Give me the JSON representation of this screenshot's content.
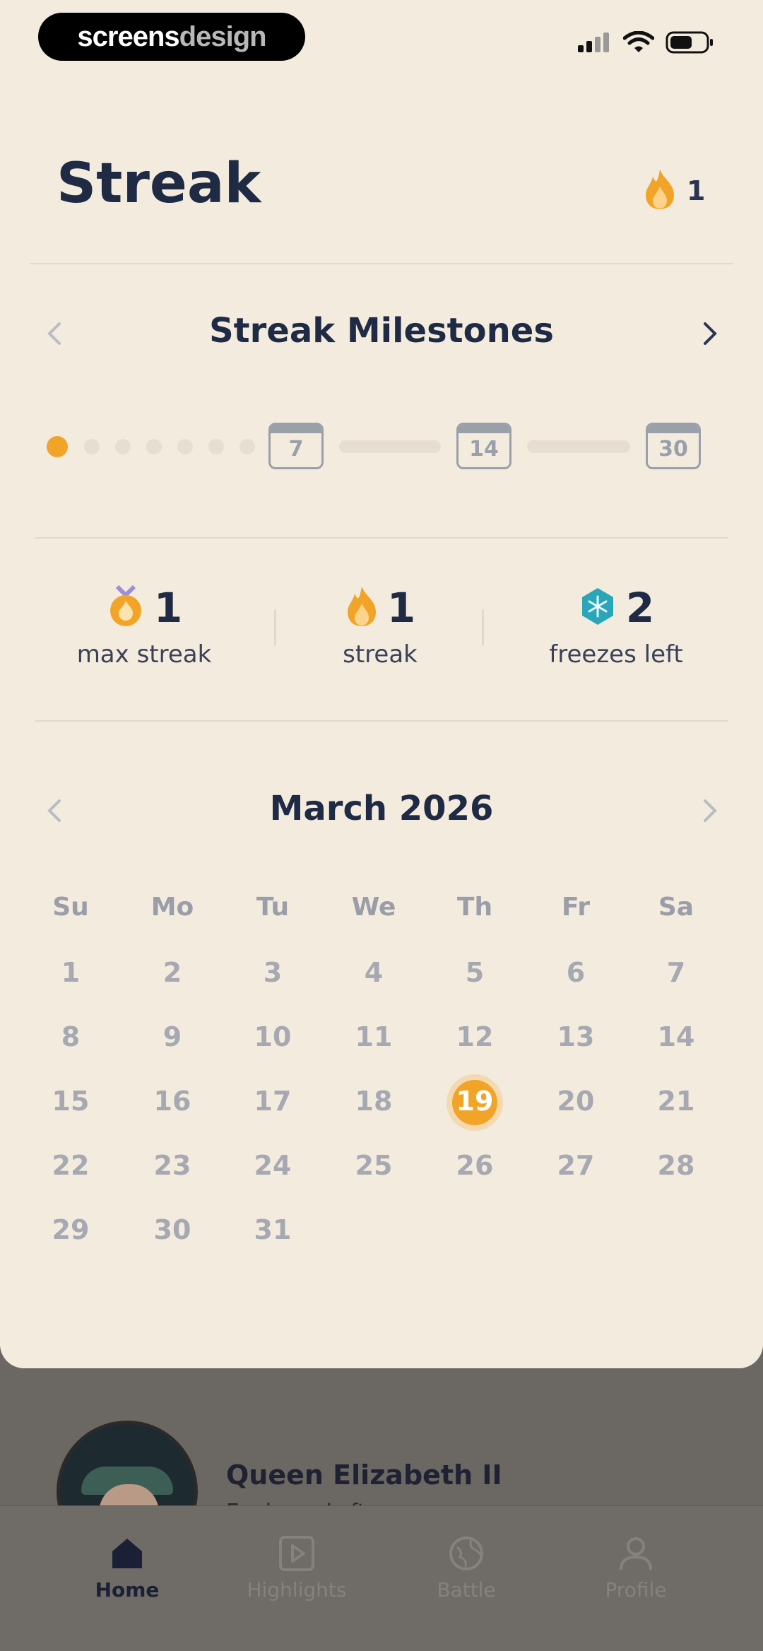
{
  "status_bar": {
    "badge_part1": "screens",
    "badge_part2": "design"
  },
  "header": {
    "title": "Streak",
    "streak_count": "1"
  },
  "milestones": {
    "title": "Streak Milestones",
    "markers": [
      "7",
      "14",
      "30"
    ],
    "progress_days": 1
  },
  "stats": [
    {
      "value": "1",
      "label": "max streak",
      "icon": "medal-flame-icon"
    },
    {
      "value": "1",
      "label": "streak",
      "icon": "flame-icon"
    },
    {
      "value": "2",
      "label": "freezes left",
      "icon": "snowflake-icon"
    }
  ],
  "calendar": {
    "month_label": "March 2026",
    "weekdays": [
      "Su",
      "Mo",
      "Tu",
      "We",
      "Th",
      "Fr",
      "Sa"
    ],
    "days": [
      "1",
      "2",
      "3",
      "4",
      "5",
      "6",
      "7",
      "8",
      "9",
      "10",
      "11",
      "12",
      "13",
      "14",
      "15",
      "16",
      "17",
      "18",
      "19",
      "20",
      "21",
      "22",
      "23",
      "24",
      "25",
      "26",
      "27",
      "28",
      "29",
      "30",
      "31"
    ],
    "today": "19"
  },
  "background": {
    "card_title": "Queen Elizabeth II",
    "card_subtitle": "Explorer. Left..."
  },
  "tabs": [
    {
      "label": "Home",
      "icon": "home-icon",
      "active": true
    },
    {
      "label": "Highlights",
      "icon": "play-icon",
      "active": false
    },
    {
      "label": "Battle",
      "icon": "globe-icon",
      "active": false
    },
    {
      "label": "Profile",
      "icon": "person-icon",
      "active": false
    }
  ],
  "colors": {
    "accent": "#f2a428",
    "sheet_bg": "#f4ebdf",
    "text_dark": "#1f2a44",
    "muted": "#a6a9b1"
  }
}
